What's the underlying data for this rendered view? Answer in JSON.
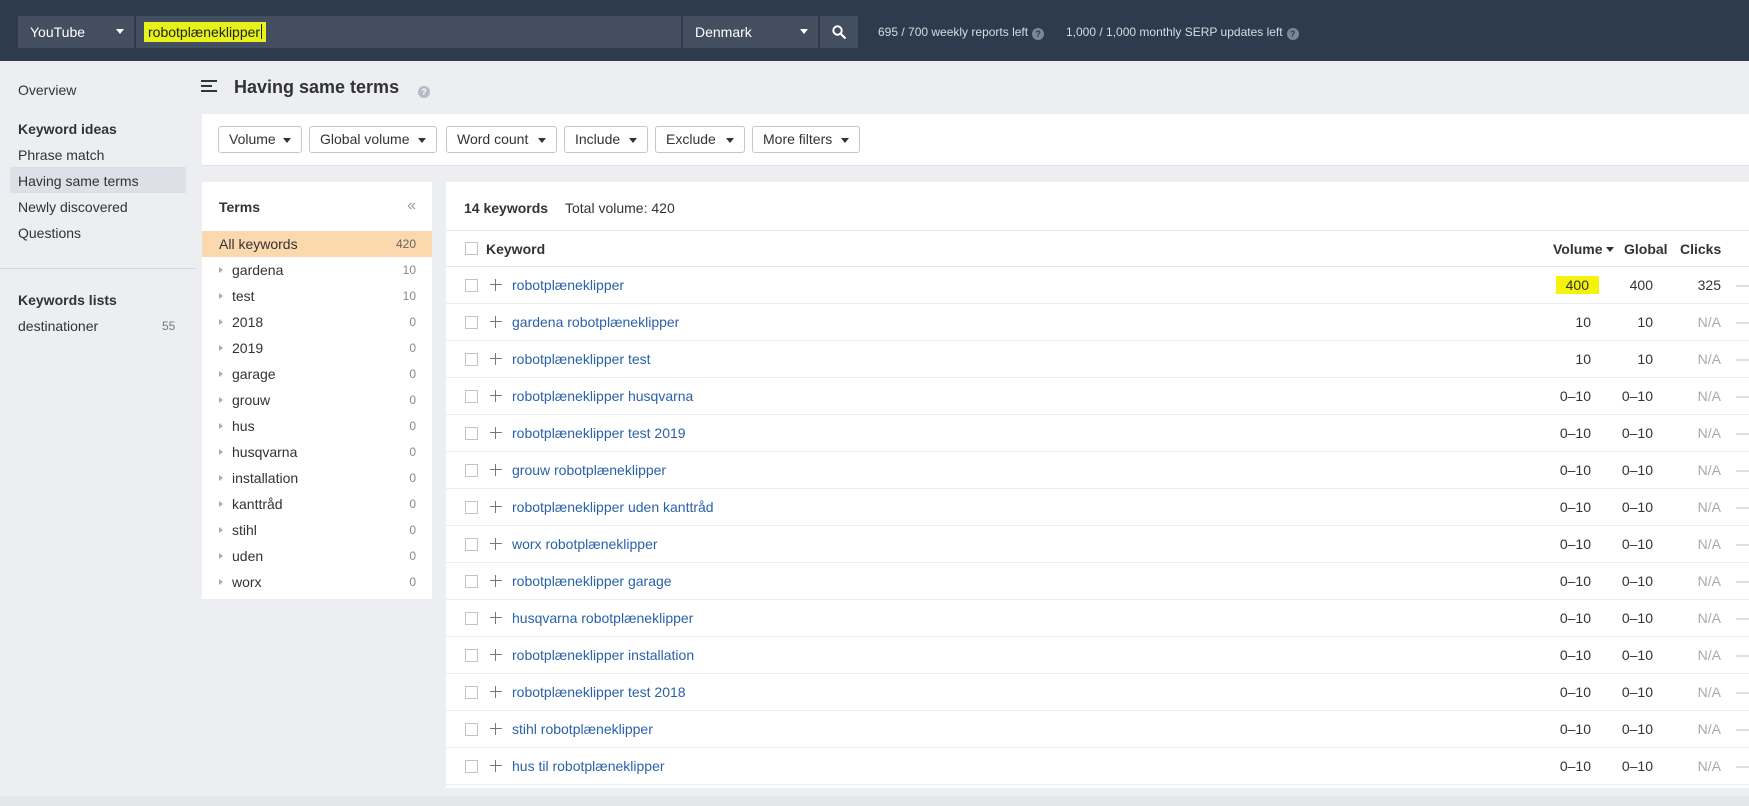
{
  "topbar": {
    "source_label": "YouTube",
    "search_value": "robotplæneklipper",
    "country_label": "Denmark",
    "reports_left": "695 / 700 weekly reports left",
    "serp_updates_left": "1,000 / 1,000 monthly SERP updates left",
    "colors": {
      "bar": "#2e3a4d",
      "input": "#434e60",
      "highlight": "#e6f21a"
    }
  },
  "nav": {
    "overview": "Overview",
    "keyword_ideas_heading": "Keyword ideas",
    "items": [
      {
        "label": "Phrase match"
      },
      {
        "label": "Having same terms",
        "active": true
      },
      {
        "label": "Newly discovered"
      },
      {
        "label": "Questions"
      }
    ],
    "lists_heading": "Keywords lists",
    "lists": [
      {
        "label": "destinationer",
        "count": "55"
      }
    ]
  },
  "header": {
    "title": "Having same terms"
  },
  "filters": [
    {
      "label": "Volume"
    },
    {
      "label": "Global volume"
    },
    {
      "label": "Word count"
    },
    {
      "label": "Include"
    },
    {
      "label": "Exclude"
    },
    {
      "label": "More filters"
    }
  ],
  "terms": {
    "title": "Terms",
    "collapse_glyph": "«",
    "rows": [
      {
        "label": "All keywords",
        "count": "420",
        "selected": true
      },
      {
        "label": "gardena",
        "count": "10"
      },
      {
        "label": "test",
        "count": "10"
      },
      {
        "label": "2018",
        "count": "0"
      },
      {
        "label": "2019",
        "count": "0"
      },
      {
        "label": "garage",
        "count": "0"
      },
      {
        "label": "grouw",
        "count": "0"
      },
      {
        "label": "hus",
        "count": "0"
      },
      {
        "label": "husqvarna",
        "count": "0"
      },
      {
        "label": "installation",
        "count": "0"
      },
      {
        "label": "kanttråd",
        "count": "0"
      },
      {
        "label": "stihl",
        "count": "0"
      },
      {
        "label": "uden",
        "count": "0"
      },
      {
        "label": "worx",
        "count": "0"
      }
    ]
  },
  "results": {
    "count_label": "14 keywords",
    "total_label": "Total volume: 420",
    "headers": {
      "keyword": "Keyword",
      "volume": "Volume",
      "global": "Global",
      "clicks": "Clicks"
    },
    "rows": [
      {
        "keyword": "robotplæneklipper",
        "volume": "400",
        "global": "400",
        "clicks": "325",
        "highlight": true
      },
      {
        "keyword": "gardena robotplæneklipper",
        "volume": "10",
        "global": "10",
        "clicks": "N/A"
      },
      {
        "keyword": "robotplæneklipper test",
        "volume": "10",
        "global": "10",
        "clicks": "N/A"
      },
      {
        "keyword": "robotplæneklipper husqvarna",
        "volume": "0–10",
        "global": "0–10",
        "clicks": "N/A"
      },
      {
        "keyword": "robotplæneklipper test 2019",
        "volume": "0–10",
        "global": "0–10",
        "clicks": "N/A"
      },
      {
        "keyword": "grouw robotplæneklipper",
        "volume": "0–10",
        "global": "0–10",
        "clicks": "N/A"
      },
      {
        "keyword": "robotplæneklipper uden kanttråd",
        "volume": "0–10",
        "global": "0–10",
        "clicks": "N/A"
      },
      {
        "keyword": "worx robotplæneklipper",
        "volume": "0–10",
        "global": "0–10",
        "clicks": "N/A"
      },
      {
        "keyword": "robotplæneklipper garage",
        "volume": "0–10",
        "global": "0–10",
        "clicks": "N/A"
      },
      {
        "keyword": "husqvarna robotplæneklipper",
        "volume": "0–10",
        "global": "0–10",
        "clicks": "N/A"
      },
      {
        "keyword": "robotplæneklipper installation",
        "volume": "0–10",
        "global": "0–10",
        "clicks": "N/A"
      },
      {
        "keyword": "robotplæneklipper test 2018",
        "volume": "0–10",
        "global": "0–10",
        "clicks": "N/A"
      },
      {
        "keyword": "stihl robotplæneklipper",
        "volume": "0–10",
        "global": "0–10",
        "clicks": "N/A"
      },
      {
        "keyword": "hus til robotplæneklipper",
        "volume": "0–10",
        "global": "0–10",
        "clicks": "N/A"
      }
    ]
  }
}
